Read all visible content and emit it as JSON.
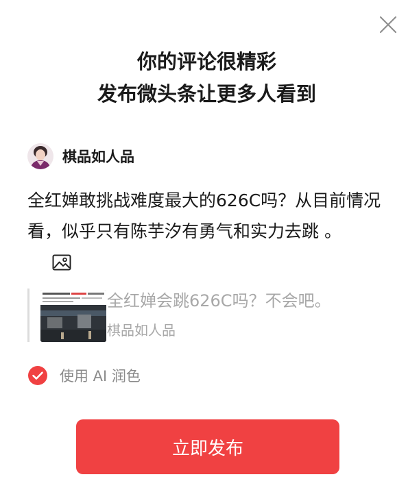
{
  "dialog": {
    "title_line1": "你的评论很精彩",
    "title_line2": "发布微头条让更多人看到"
  },
  "author": {
    "name": "棋品如人品"
  },
  "comment": {
    "text": "全红婵敢挑战难度最大的626C吗？从目前情况看，似乎只有陈芋汐有勇气和实力去跳 。"
  },
  "quote": {
    "title": "全红婵会跳626C吗？不会吧。",
    "author": "棋品如人品"
  },
  "ai_polish": {
    "label": "使用 AI 润色",
    "checked": true
  },
  "publish": {
    "label": "立即发布"
  },
  "colors": {
    "accent": "#f04142",
    "muted_text": "#a8a8a8",
    "primary_text": "#1a1a1a"
  },
  "icons": {
    "close": "close-icon",
    "image": "image-icon",
    "check": "check-circle-icon"
  }
}
